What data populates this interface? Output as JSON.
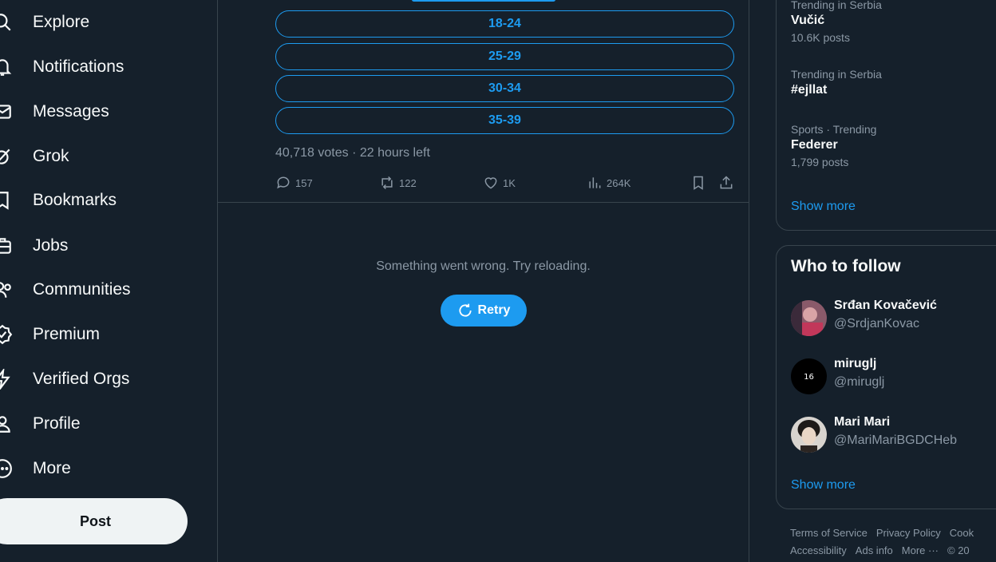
{
  "nav": {
    "explore": "Explore",
    "notifications": "Notifications",
    "messages": "Messages",
    "grok": "Grok",
    "bookmarks": "Bookmarks",
    "jobs": "Jobs",
    "communities": "Communities",
    "premium": "Premium",
    "verified_orgs": "Verified Orgs",
    "profile": "Profile",
    "more": "More",
    "post_button": "Post"
  },
  "poll": {
    "options": [
      "18-24",
      "25-29",
      "30-34",
      "35-39"
    ],
    "meta": "40,718 votes · 22 hours left"
  },
  "tweet_actions": {
    "replies": "157",
    "reposts": "122",
    "likes": "1K",
    "views": "264K"
  },
  "error": {
    "message": "Something went wrong. Try reloading.",
    "retry_label": "Retry"
  },
  "trends": {
    "items": [
      {
        "context": "Trending in Serbia",
        "name": "Vučić",
        "posts": "10.6K posts"
      },
      {
        "context": "Trending in Serbia",
        "name": "#ejllat",
        "posts": ""
      },
      {
        "context": "Sports · Trending",
        "name": "Federer",
        "posts": "1,799 posts"
      }
    ],
    "show_more": "Show more"
  },
  "who_to_follow": {
    "title": "Who to follow",
    "accounts": [
      {
        "name": "Srđan Kovačević",
        "handle": "@SrdjanKovac"
      },
      {
        "name": "miruglj",
        "handle": "@miruglj"
      },
      {
        "name": "Mari Mari",
        "handle": "@MariMariBGDCHeb"
      }
    ],
    "show_more": "Show more"
  },
  "footer": {
    "terms": "Terms of Service",
    "privacy": "Privacy Policy",
    "cookie": "Cook",
    "accessibility": "Accessibility",
    "ads_info": "Ads info",
    "more": "More ···",
    "copyright": "© 20"
  },
  "colors": {
    "background": "#15202b",
    "accent": "#1d9bf0",
    "border": "#38444d",
    "muted_text": "#8b98a5"
  }
}
